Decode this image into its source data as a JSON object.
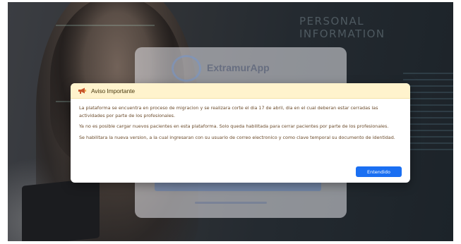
{
  "background": {
    "personal_info_text": "PERSONAL INFORMATION",
    "app_name": "ExtramurApp"
  },
  "modal": {
    "title": "Aviso Importante",
    "paragraphs": [
      "La plataforma se encuentra en proceso de migracion y se realizara corte el dia 17 de abril, dia en el cual deberan estar cerradas las actividades por parte de los profesionales.",
      "Ya no es posible cargar nuevos pacientes en esta plataforma. Solo queda habilitada para cerrar pacientes por parte de los profesionales.",
      "Se habilitara la nueva version, a la cual ingresaran con su usuario de correo electronico y como clave temporal su documento de identidad."
    ],
    "button_label": "Entendido",
    "icon": "megaphone-icon",
    "colors": {
      "header_bg": "#fff3cd",
      "body_text": "#6a4a2a",
      "button_bg": "#1a6ff2"
    }
  }
}
